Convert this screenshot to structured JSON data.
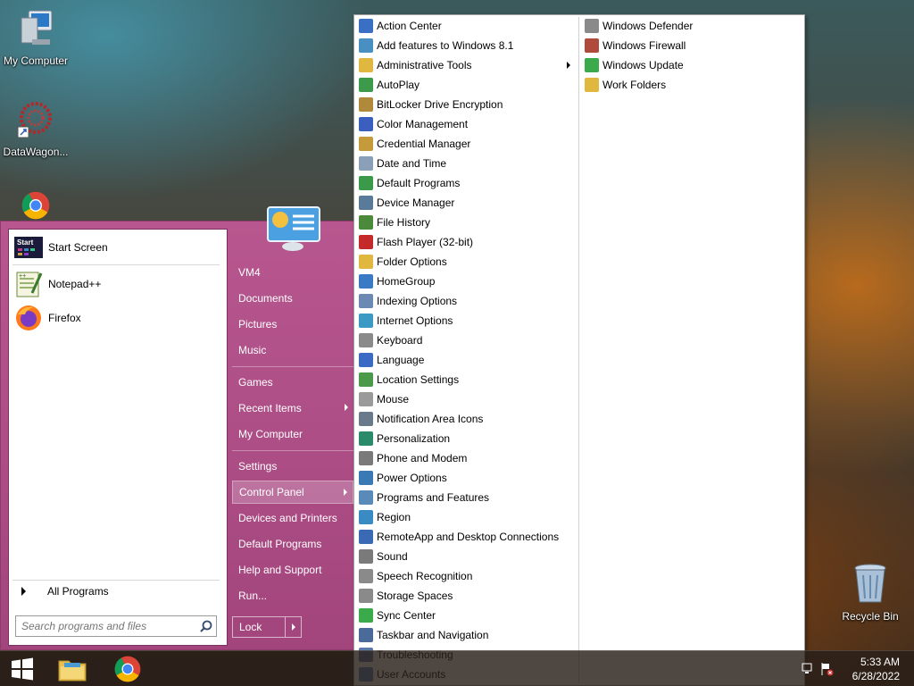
{
  "desktop": {
    "icons": [
      {
        "label": "My Computer"
      },
      {
        "label": "DataWagon..."
      },
      {
        "label": "Recycle Bin"
      }
    ]
  },
  "taskbar": {
    "time": "5:33 AM",
    "date": "6/28/2022"
  },
  "start_menu": {
    "pinned": [
      {
        "label": "Start Screen",
        "icon": "start-screen-icon"
      },
      {
        "label": "Notepad++",
        "icon": "notepadpp-icon"
      },
      {
        "label": "Firefox",
        "icon": "firefox-icon"
      }
    ],
    "all_programs": "All Programs",
    "search_placeholder": "Search programs and files",
    "right_items": [
      {
        "label": "VM4"
      },
      {
        "label": "Documents"
      },
      {
        "label": "Pictures"
      },
      {
        "label": "Music"
      },
      {
        "label": "Games"
      },
      {
        "label": "Recent Items"
      },
      {
        "label": "My Computer"
      },
      {
        "label": "Settings"
      },
      {
        "label": "Control Panel"
      },
      {
        "label": "Devices and Printers"
      },
      {
        "label": "Default Programs"
      },
      {
        "label": "Help and Support"
      },
      {
        "label": "Run..."
      }
    ],
    "lock_label": "Lock"
  },
  "control_panel": {
    "col1": [
      {
        "label": "Action Center",
        "color": "#3a6fc4"
      },
      {
        "label": "Add features to Windows 8.1",
        "color": "#4a8fc2"
      },
      {
        "label": "Administrative Tools",
        "color": "#e0b840"
      },
      {
        "label": "AutoPlay",
        "color": "#3d9a4a"
      },
      {
        "label": "BitLocker Drive Encryption",
        "color": "#b08a3a"
      },
      {
        "label": "Color Management",
        "color": "#3a5fbf"
      },
      {
        "label": "Credential Manager",
        "color": "#c49a3a"
      },
      {
        "label": "Date and Time",
        "color": "#8aa0b8"
      },
      {
        "label": "Default Programs",
        "color": "#3a9a4a"
      },
      {
        "label": "Device Manager",
        "color": "#5a7a9a"
      },
      {
        "label": "File History",
        "color": "#4a8a3a"
      },
      {
        "label": "Flash Player (32-bit)",
        "color": "#c42a2a"
      },
      {
        "label": "Folder Options",
        "color": "#e0b840"
      },
      {
        "label": "HomeGroup",
        "color": "#3a7ac4"
      },
      {
        "label": "Indexing Options",
        "color": "#6a8ab4"
      },
      {
        "label": "Internet Options",
        "color": "#3a9ac4"
      },
      {
        "label": "Keyboard",
        "color": "#8a8a8a"
      },
      {
        "label": "Language",
        "color": "#3a6ac4"
      },
      {
        "label": "Location Settings",
        "color": "#4a9a4a"
      },
      {
        "label": "Mouse",
        "color": "#9a9a9a"
      },
      {
        "label": "Notification Area Icons",
        "color": "#6a7a8a"
      },
      {
        "label": "Personalization",
        "color": "#2a8a6a"
      },
      {
        "label": "Phone and Modem",
        "color": "#7a7a7a"
      },
      {
        "label": "Power Options",
        "color": "#3a7ab4"
      },
      {
        "label": "Programs and Features",
        "color": "#5a8aba"
      },
      {
        "label": "Region",
        "color": "#3a8ac4"
      },
      {
        "label": "RemoteApp and Desktop Connections",
        "color": "#3a6ab4"
      },
      {
        "label": "Sound",
        "color": "#7a7a7a"
      },
      {
        "label": "Speech Recognition",
        "color": "#8a8a8a"
      },
      {
        "label": "Storage Spaces",
        "color": "#8a8a8a"
      },
      {
        "label": "Sync Center",
        "color": "#3aaa4a"
      },
      {
        "label": "Taskbar and Navigation",
        "color": "#4a6a9a"
      },
      {
        "label": "Troubleshooting",
        "color": "#5a7aaa"
      },
      {
        "label": "User Accounts",
        "color": "#5a8ac4"
      }
    ],
    "col2": [
      {
        "label": "Windows Defender",
        "color": "#8a8a8a"
      },
      {
        "label": "Windows Firewall",
        "color": "#b04a3a"
      },
      {
        "label": "Windows Update",
        "color": "#3aaa4a"
      },
      {
        "label": "Work Folders",
        "color": "#e0b840"
      }
    ]
  }
}
